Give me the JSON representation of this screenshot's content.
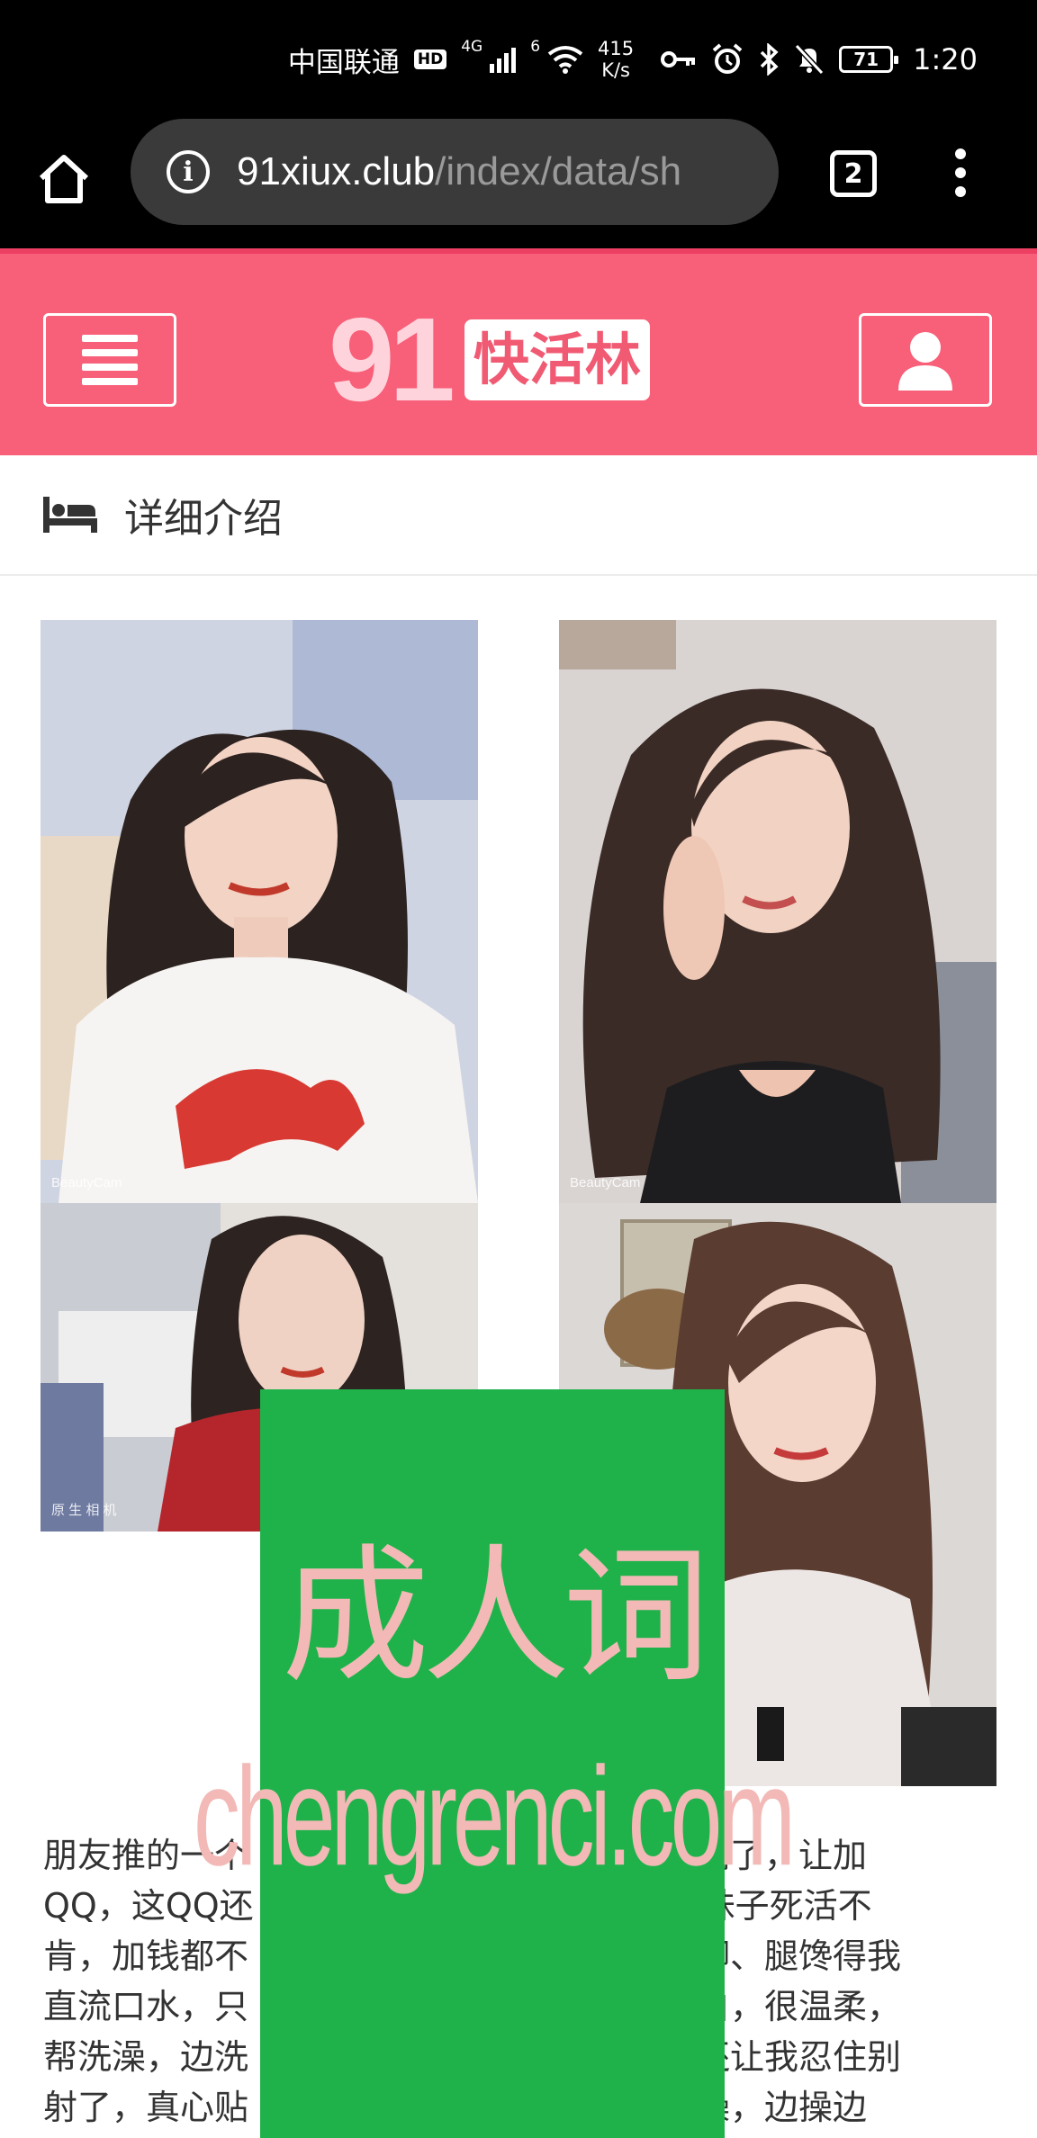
{
  "status_bar": {
    "carrier": "中国联通",
    "hd_badge": "HD",
    "network_1": "4G",
    "network_2": "6",
    "speed_value": "415",
    "speed_unit": "K/s",
    "battery": "71",
    "time": "1:20",
    "icons": [
      "key-icon",
      "alarm-icon",
      "bluetooth-icon",
      "mute-icon"
    ]
  },
  "browser": {
    "url_host": "91xiux.club",
    "url_path": "/index/data/sh",
    "tab_count": "2"
  },
  "site_header": {
    "logo_number": "91",
    "logo_text": "快活林",
    "background_color": "#f85f78"
  },
  "section": {
    "title": "详细介绍"
  },
  "photos": [
    {
      "label": "BeautyCam"
    },
    {
      "label": "BeautyCam"
    },
    {
      "label": "原 生 相 机"
    },
    {
      "label": ""
    }
  ],
  "body_text_lines": [
    "朋友推的一个                                      加满了，让加",
    "QQ，这QQ还                                      ，妹子死活不",
    "肯，加钱都不                                      个脚、腿馋得我",
    "直流口水，只                                      很白，很温柔，",
    "帮洗澡，边洗                                      ，还让我忍住别",
    "射了，真心贴                                      挨操，边操边"
  ],
  "watermark": {
    "text_cn": "成人词",
    "text_en": "chengrenci.com",
    "color": "#1fb24a"
  }
}
